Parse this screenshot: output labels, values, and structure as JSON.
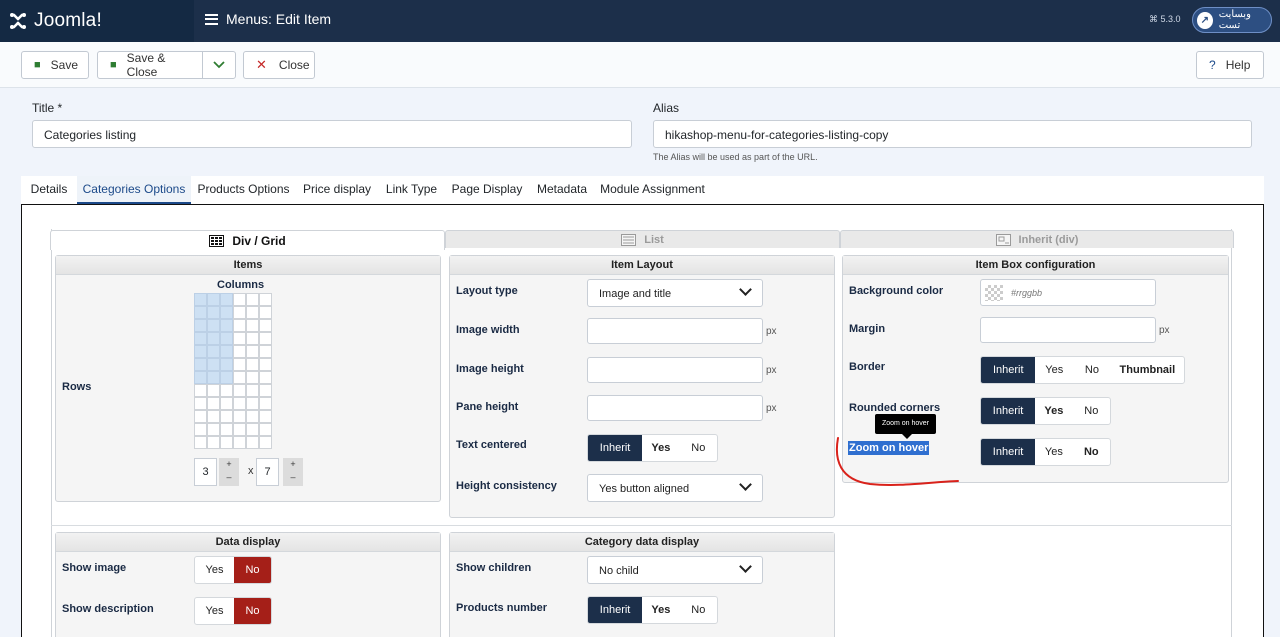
{
  "header": {
    "logo_text": "Joomla!",
    "page_title": "Menus: Edit Item",
    "version": "5.3.0",
    "site_link": "وبسایت تست"
  },
  "toolbar": {
    "save": "Save",
    "save_close": "Save & Close",
    "close": "Close",
    "help": "Help"
  },
  "form": {
    "title_label": "Title *",
    "title_value": "Categories listing",
    "alias_label": "Alias",
    "alias_value": "hikashop-menu-for-categories-listing-copy",
    "alias_hint": "The Alias will be used as part of the URL."
  },
  "tabs": [
    "Details",
    "Categories Options",
    "Products Options",
    "Price display",
    "Link Type",
    "Page Display",
    "Metadata",
    "Module Assignment"
  ],
  "active_tab": "Categories Options",
  "modes": [
    "Div / Grid",
    "List",
    "Inherit (div)"
  ],
  "items": {
    "header": "Items",
    "columns_label": "Columns",
    "rows_label": "Rows",
    "columns_value": "3",
    "x": "x",
    "rows_value": "7",
    "plus": "+",
    "minus": "–"
  },
  "item_layout": {
    "header": "Item Layout",
    "layout_type_label": "Layout type",
    "layout_type_value": "Image and title",
    "image_width_label": "Image width",
    "image_height_label": "Image height",
    "pane_height_label": "Pane height",
    "text_centered_label": "Text centered",
    "height_consistency_label": "Height consistency",
    "height_consistency_value": "Yes button aligned",
    "unit": "px"
  },
  "item_box": {
    "header": "Item Box configuration",
    "bg_color_label": "Background color",
    "bg_color_placeholder": "#rrggbb",
    "margin_label": "Margin",
    "border_label": "Border",
    "rounded_corners_label": "Rounded corners",
    "zoom_label": "Zoom on hover",
    "tooltip": "Zoom on hover"
  },
  "data_display": {
    "header": "Data display",
    "show_image_label": "Show image",
    "show_description_label": "Show description"
  },
  "category_data_display": {
    "header": "Category data display",
    "show_children_label": "Show children",
    "show_children_value": "No child",
    "products_number_label": "Products number"
  },
  "options": {
    "inherit": "Inherit",
    "yes": "Yes",
    "no": "No",
    "thumbnail": "Thumbnail"
  },
  "colors": {
    "navy": "#1c2f4a",
    "red_no": "#a51f18",
    "accent": "#1c4a8a",
    "annotation": "#d9221b"
  }
}
